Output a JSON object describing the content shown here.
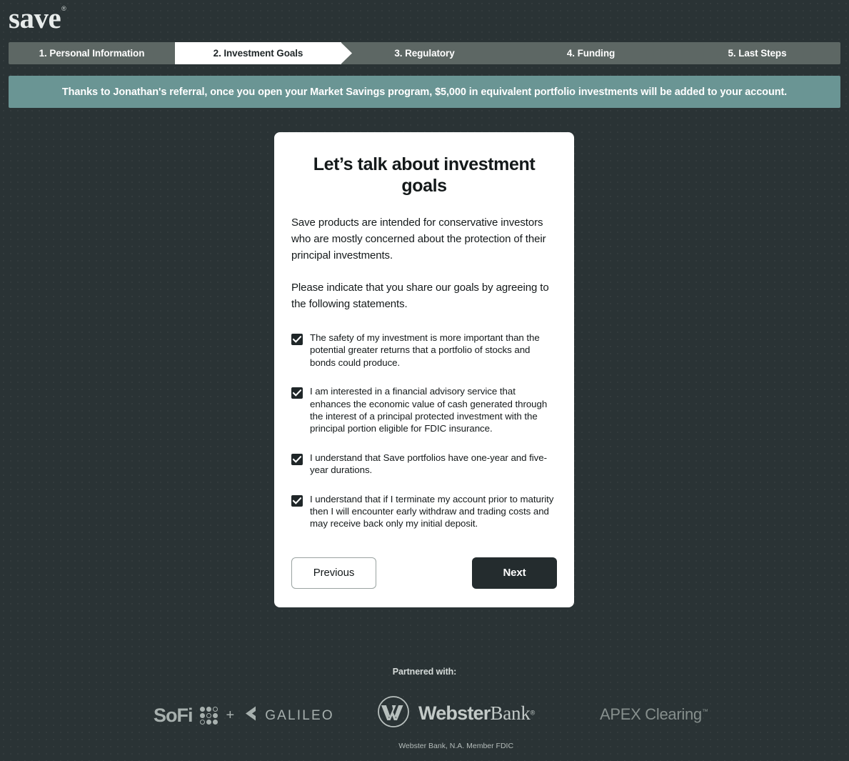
{
  "brand": {
    "logo_text": "save",
    "logo_mark": "®"
  },
  "colors": {
    "page_background": "#2a3335",
    "step_inactive": "#5d6764",
    "step_active": "#ffffff",
    "banner_background": "#6a9594",
    "card_background": "#ffffff",
    "primary_button": "#242c2e",
    "text_dark": "#14191a",
    "footer_logo_gray": "#a7b0ae"
  },
  "stepper": {
    "steps": [
      {
        "label": "1. Personal Information",
        "active": false
      },
      {
        "label": "2. Investment Goals",
        "active": true
      },
      {
        "label": "3. Regulatory",
        "active": false
      },
      {
        "label": "4. Funding",
        "active": false
      },
      {
        "label": "5. Last Steps",
        "active": false
      }
    ]
  },
  "banner": {
    "text": "Thanks to Jonathan's referral, once you open your Market Savings program, $5,000 in equivalent portfolio investments will be added to your account.",
    "referrer_name": "Jonathan",
    "program": "Market Savings",
    "bonus_amount": "$5,000"
  },
  "card": {
    "title": "Let’s talk about investment goals",
    "paragraph_1": "Save products are intended for conservative investors who are mostly concerned about the protection of their principal investments.",
    "paragraph_2": "Please indicate that you share our goals by agreeing to the following statements.",
    "statements": [
      {
        "label": "The safety of my investment is more important than the potential greater returns that a portfolio of stocks and bonds could produce.",
        "checked": true
      },
      {
        "label": "I am interested in a financial advisory service that enhances the economic value of cash generated through the interest of a principal protected investment with the principal portion eligible for FDIC insurance.",
        "checked": true
      },
      {
        "label": "I understand that Save portfolios have one-year and five-year durations.",
        "checked": true
      },
      {
        "label": "I understand that if I terminate my account prior to maturity then I will encounter early withdraw and trading costs and may receive back only my initial deposit.",
        "checked": true
      }
    ],
    "previous_button": "Previous",
    "next_button": "Next"
  },
  "footer": {
    "partnered_with": "Partnered with:",
    "sofi": {
      "name": "SoFi",
      "icon": "sofi-dot-matrix-icon"
    },
    "plus": "+",
    "galileo": {
      "name": "GALILEO",
      "icon": "galileo-chevron-icon"
    },
    "webster": {
      "name_bold": "Webster",
      "name_serif": "Bank",
      "trademark": "®",
      "disclosure": "Webster Bank, N.A.  Member FDIC",
      "icon": "webster-w-circle-icon"
    },
    "apex": {
      "name": "APEX Clearing",
      "trademark": "™"
    }
  }
}
